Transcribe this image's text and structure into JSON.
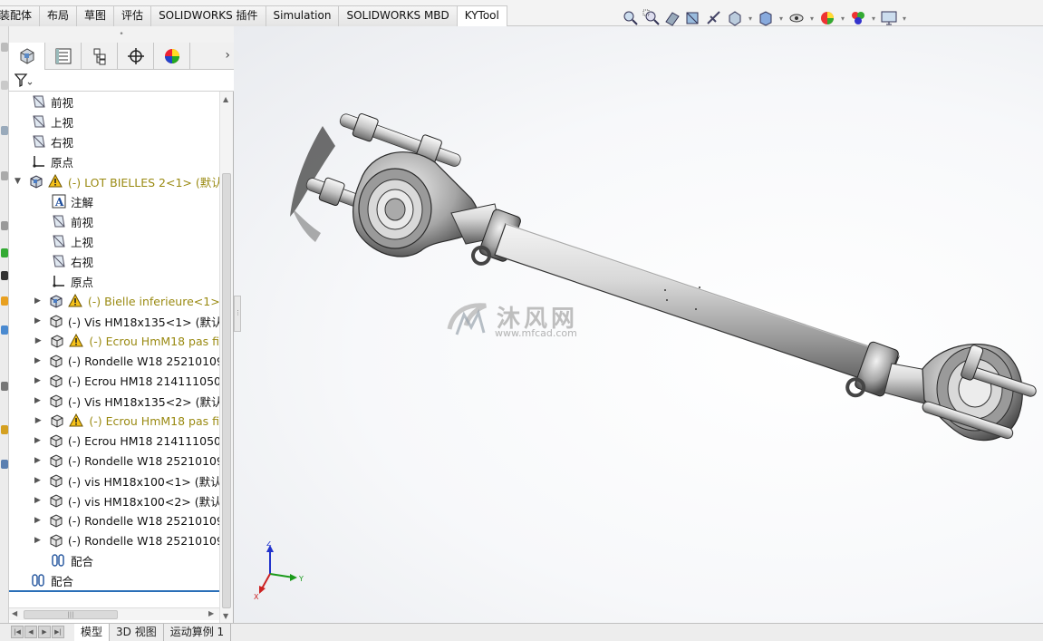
{
  "tabs": [
    {
      "label": "装配体"
    },
    {
      "label": "布局"
    },
    {
      "label": "草图"
    },
    {
      "label": "评估"
    },
    {
      "label": "SOLIDWORKS 插件"
    },
    {
      "label": "Simulation"
    },
    {
      "label": "SOLIDWORKS MBD"
    },
    {
      "label": "KYTool",
      "active": true
    }
  ],
  "view_toolbar": [
    "zoom-to-fit-icon",
    "zoom-area-icon",
    "previous-view-icon",
    "section-view-icon",
    "dynamic-annotation-icon",
    "view-orientation-icon",
    "display-style-icon",
    "hide-show-icon",
    "edit-appearance-icon",
    "apply-scene-icon",
    "view-settings-icon"
  ],
  "panel": {
    "tab_icons": [
      "feature-manager-icon",
      "property-manager-icon",
      "configuration-manager-icon",
      "dimxpert-icon",
      "display-manager-icon"
    ]
  },
  "tree": [
    {
      "label": "前视",
      "icon": "plane-icon",
      "level": 1
    },
    {
      "label": "上视",
      "icon": "plane-icon",
      "level": 1
    },
    {
      "label": "右视",
      "icon": "plane-icon",
      "level": 1
    },
    {
      "label": "原点",
      "icon": "origin-icon",
      "level": 1
    },
    {
      "label": "(-) LOT BIELLES 2<1> (默认",
      "icon": "assembly-icon",
      "level": 1,
      "warning": true,
      "expanded": true
    },
    {
      "label": "注解",
      "icon": "annotation-icon",
      "level": 2
    },
    {
      "label": "前视",
      "icon": "plane-icon",
      "level": 2
    },
    {
      "label": "上视",
      "icon": "plane-icon",
      "level": 2
    },
    {
      "label": "右视",
      "icon": "plane-icon",
      "level": 2
    },
    {
      "label": "原点",
      "icon": "origin-icon",
      "level": 2
    },
    {
      "label": "(-) Bielle inferieure<1>",
      "icon": "assembly-icon",
      "level": 2,
      "warning": true,
      "collapsed": true
    },
    {
      "label": "(-) Vis HM18x135<1> (默认",
      "icon": "part-icon",
      "level": 2,
      "collapsed": true
    },
    {
      "label": "(-) Ecrou HmM18 pas fi",
      "icon": "part-icon",
      "level": 2,
      "warning": true,
      "collapsed": true
    },
    {
      "label": "(-) Rondelle W18 25210109",
      "icon": "part-icon",
      "level": 2,
      "collapsed": true
    },
    {
      "label": "(-) Ecrou HM18 214111050-",
      "icon": "part-icon",
      "level": 2,
      "collapsed": true
    },
    {
      "label": "(-) Vis HM18x135<2> (默认",
      "icon": "part-icon",
      "level": 2,
      "collapsed": true
    },
    {
      "label": "(-) Ecrou HmM18 pas fi",
      "icon": "part-icon",
      "level": 2,
      "warning": true,
      "collapsed": true
    },
    {
      "label": "(-) Ecrou HM18 214111050-",
      "icon": "part-icon",
      "level": 2,
      "collapsed": true
    },
    {
      "label": "(-) Rondelle W18 25210109",
      "icon": "part-icon",
      "level": 2,
      "collapsed": true
    },
    {
      "label": "(-) vis HM18x100<1> (默认",
      "icon": "part-icon",
      "level": 2,
      "collapsed": true
    },
    {
      "label": "(-) vis HM18x100<2> (默认",
      "icon": "part-icon",
      "level": 2,
      "collapsed": true
    },
    {
      "label": "(-) Rondelle W18 25210109",
      "icon": "part-icon",
      "level": 2,
      "collapsed": true
    },
    {
      "label": "(-) Rondelle W18 25210109",
      "icon": "part-icon",
      "level": 2,
      "collapsed": true
    },
    {
      "label": "配合",
      "icon": "mates-icon",
      "level": 2
    },
    {
      "label": "配合",
      "icon": "mates-icon",
      "level": 1
    }
  ],
  "bottom_tabs": [
    {
      "label": "模型",
      "active": true
    },
    {
      "label": "3D 视图"
    },
    {
      "label": "运动算例 1"
    }
  ],
  "watermark": {
    "cn": "沐风网",
    "url": "www.mfcad.com"
  },
  "triad": {
    "x": "X",
    "y": "Y",
    "z": "Z"
  },
  "colors": {
    "warning_text": "#9a8a12",
    "selection_line": "#2a6fb8"
  }
}
